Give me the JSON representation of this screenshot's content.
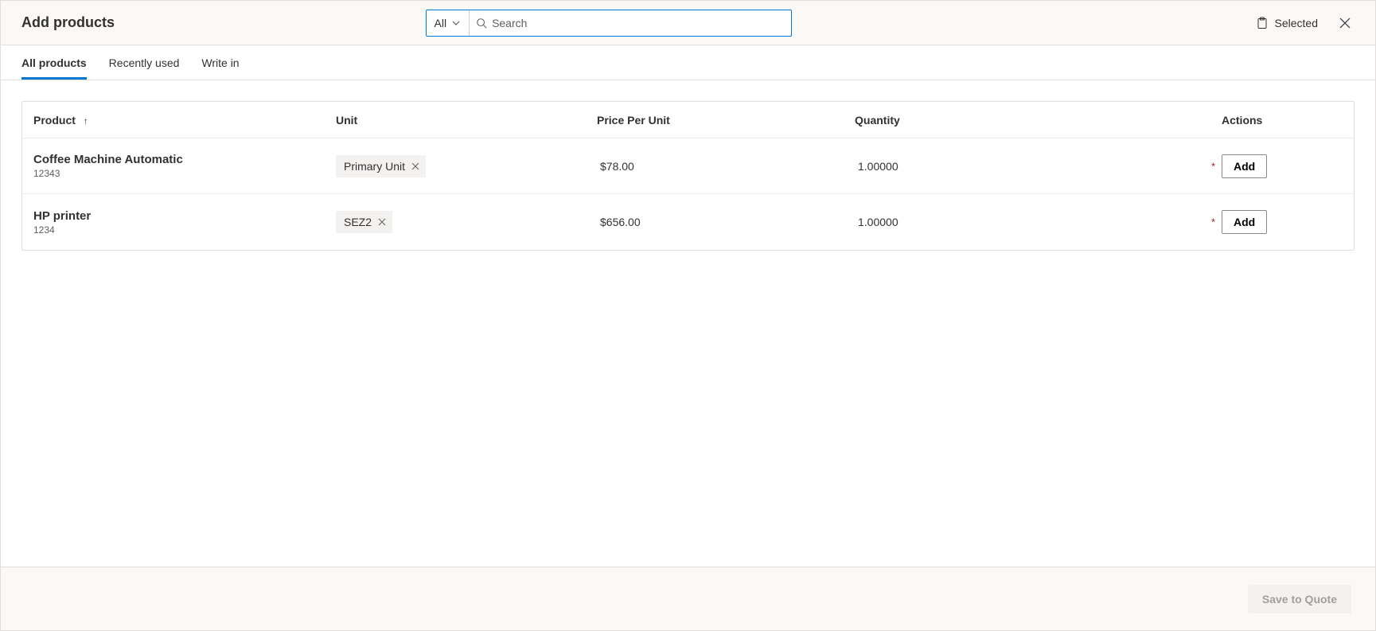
{
  "header": {
    "title": "Add products",
    "filter_label": "All",
    "search_placeholder": "Search",
    "selected_label": "Selected"
  },
  "tabs": [
    {
      "label": "All products",
      "active": true
    },
    {
      "label": "Recently used",
      "active": false
    },
    {
      "label": "Write in",
      "active": false
    }
  ],
  "columns": {
    "product": "Product",
    "unit": "Unit",
    "price": "Price Per Unit",
    "quantity": "Quantity",
    "actions": "Actions"
  },
  "rows": [
    {
      "name": "Coffee Machine Automatic",
      "code": "12343",
      "unit": "Primary Unit",
      "price": "$78.00",
      "quantity": "1.00000",
      "action_label": "Add"
    },
    {
      "name": "HP printer",
      "code": "1234",
      "unit": "SEZ2",
      "price": "$656.00",
      "quantity": "1.00000",
      "action_label": "Add"
    }
  ],
  "footer": {
    "save_label": "Save to Quote"
  }
}
